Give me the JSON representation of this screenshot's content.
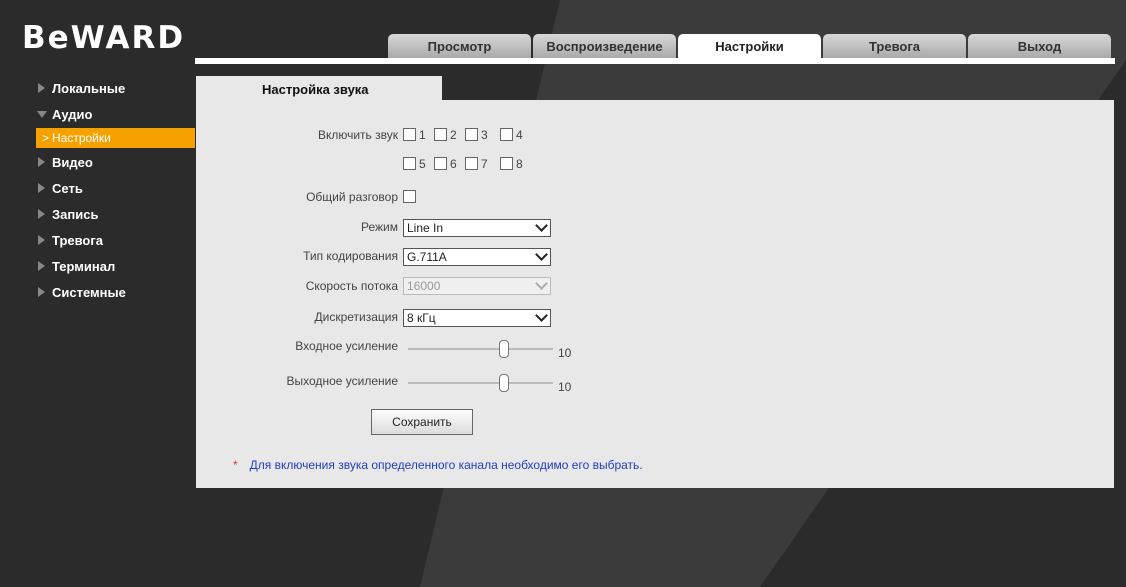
{
  "brand": "BeWARD",
  "tabs": [
    "Просмотр",
    "Воспроизведение",
    "Настройки",
    "Тревога",
    "Выход"
  ],
  "active_tab": "Настройки",
  "sidebar": {
    "items": [
      {
        "label": "Локальные"
      },
      {
        "label": "Аудио"
      },
      {
        "label": "Настройки",
        "selected": true
      },
      {
        "label": "Видео"
      },
      {
        "label": "Сеть"
      },
      {
        "label": "Запись"
      },
      {
        "label": "Тревога"
      },
      {
        "label": "Терминал"
      },
      {
        "label": "Системные"
      }
    ]
  },
  "panel": {
    "title": "Настройка звука",
    "enable_sound_label": "Включить звук",
    "channels_row1": [
      "1",
      "2",
      "3",
      "4"
    ],
    "channels_row2": [
      "5",
      "6",
      "7",
      "8"
    ],
    "common_talk_label": "Общий разговор",
    "mode_label": "Режим",
    "mode_value": "Line In",
    "encoding_label": "Тип кодирования",
    "encoding_value": "G.711A",
    "bitrate_label": "Скорость потока",
    "bitrate_value": "16000",
    "sampling_label": "Дискретизация",
    "sampling_value": "8 кГц",
    "input_gain_label": "Входное усиление",
    "input_gain_value": "10",
    "output_gain_label": "Выходное усиление",
    "output_gain_value": "10",
    "save_label": "Сохранить",
    "note_star": "*",
    "note_text": "Для включения звука определенного канала необходимо его выбрать."
  },
  "colors": {
    "accent": "#f5a200",
    "background": "#2b2b2b",
    "panel": "#e8e8e8",
    "note_text": "#1f3fbf"
  }
}
